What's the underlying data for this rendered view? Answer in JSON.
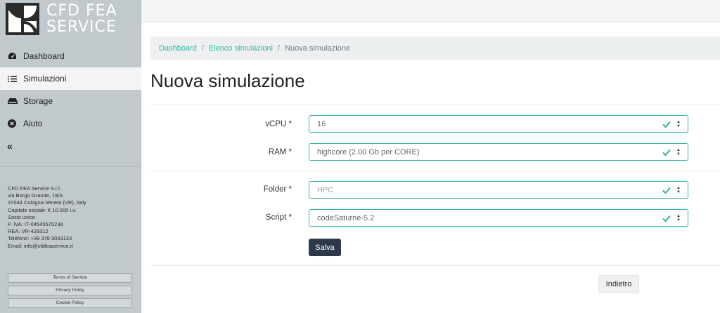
{
  "brand": {
    "line1": "CFD FEA",
    "line2": "SERVICE"
  },
  "nav": {
    "items": [
      {
        "label": "Dashboard",
        "icon": "dashboard-gauge-icon"
      },
      {
        "label": "Simulazioni",
        "icon": "list-icon"
      },
      {
        "label": "Storage",
        "icon": "hdd-icon"
      },
      {
        "label": "Aiuto",
        "icon": "help-circle-icon"
      }
    ],
    "collapse_label": "«"
  },
  "company": {
    "lines": [
      "CFD FEA Service S.r.l.",
      "via Borgo Grande, 19/A",
      "37044 Cologna Veneta (VR), Italy",
      "Capitale sociale: € 10.000 i.v.",
      "Socio unico",
      "P. IVA: IT-04545570238",
      "REA: VR-429312",
      "Telefono: +39 378 3033133",
      "Email: info@cfdfeaservice.it"
    ]
  },
  "legal": {
    "terms": "Terms of Service",
    "privacy": "Privacy Policy",
    "cookie": "Cookie Policy"
  },
  "breadcrumb": {
    "dashboard": "Dashboard",
    "sep": "/",
    "list": "Elenco simulazioni",
    "current": "Nuova simulazione"
  },
  "page": {
    "title": "Nuova simulazione"
  },
  "form": {
    "vcpu": {
      "label": "vCPU *",
      "value": "16"
    },
    "ram": {
      "label": "RAM *",
      "value": "highcore (2.00 Gb per CORE)"
    },
    "folder": {
      "label": "Folder *",
      "value": "HPC"
    },
    "script": {
      "label": "Script *",
      "value": "codeSaturne-5.2"
    },
    "save_label": "Salva"
  },
  "back_label": "Indietro",
  "colors": {
    "accent": "#2fb49b",
    "primary_button": "#2d3a4a",
    "sidebar": "#c2c9cd"
  }
}
